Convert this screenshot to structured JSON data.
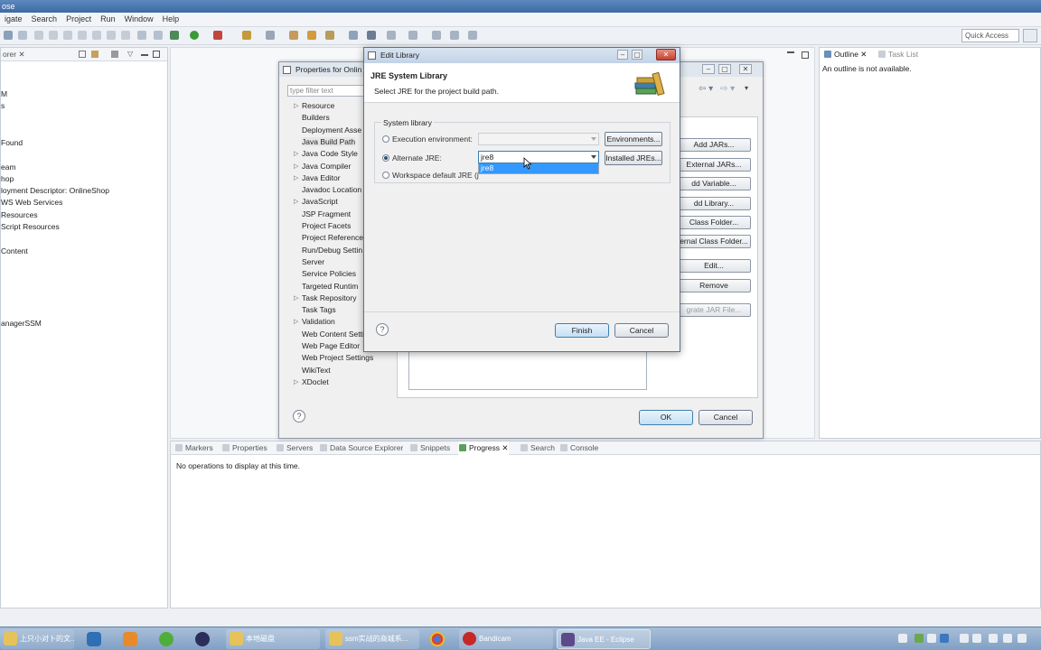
{
  "titlebar": {
    "text": "ose"
  },
  "menu": [
    "igate",
    "Search",
    "Project",
    "Run",
    "Window",
    "Help"
  ],
  "toolbar": {
    "quick_access": "Quick Access"
  },
  "explorer": {
    "tab": "orer",
    "tree": [
      "M",
      "s",
      "",
      "Found",
      "",
      "eam",
      "hop",
      "loyment Descriptor: OnlineShop",
      "WS Web Services",
      "Resources",
      "Script Resources",
      "",
      "Content",
      "",
      "",
      "",
      "",
      "",
      "anagerSSM"
    ]
  },
  "outline": {
    "tab_outline": "Outline",
    "tab_tasks": "Task List",
    "message": "An outline is not available."
  },
  "bottom": {
    "tabs": [
      "Markers",
      "Properties",
      "Servers",
      "Data Source Explorer",
      "Snippets",
      "Progress",
      "Search",
      "Console"
    ],
    "message": "No operations to display at this time."
  },
  "properties": {
    "title": "Properties for Onlin",
    "filter_placeholder": "type filter text",
    "nav": [
      "Resource",
      "Builders",
      "Deployment Asse",
      "Java Build Path",
      "Java Code Style",
      "Java Compiler",
      "Java Editor",
      "Javadoc Location",
      "JavaScript",
      "JSP Fragment",
      "Project Facets",
      "Project Reference",
      "Run/Debug Settin",
      "Server",
      "Service Policies",
      "Targeted Runtim",
      "Task Repository",
      "Task Tags",
      "Validation",
      "Web Content Setti",
      "Web Page Editor",
      "Web Project Settings",
      "WikiText",
      "XDoclet"
    ],
    "side_buttons": [
      "Add JARs...",
      "External JARs...",
      "dd Variable...",
      "dd Library...",
      "Class Folder...",
      "ernal Class Folder...",
      "Edit...",
      "Remove",
      "grate JAR File..."
    ],
    "ok": "OK",
    "cancel": "Cancel"
  },
  "edit_library": {
    "title": "Edit Library",
    "heading": "JRE System Library",
    "description": "Select JRE for the project build path.",
    "group_label": "System library",
    "opt_env": "Execution environment:",
    "opt_alt": "Alternate JRE:",
    "opt_ws": "Workspace default JRE (j",
    "alt_value": "jre8",
    "dropdown_item": "jre8",
    "btn_environments": "Environments...",
    "btn_installed": "Installed JREs...",
    "finish": "Finish",
    "cancel": "Cancel"
  },
  "taskbar": {
    "tasks": [
      "上只小对卜的文...",
      "本地磁盘",
      "ssm实战的商城系...",
      "Bandicam",
      "Java EE - Eclipse"
    ]
  }
}
